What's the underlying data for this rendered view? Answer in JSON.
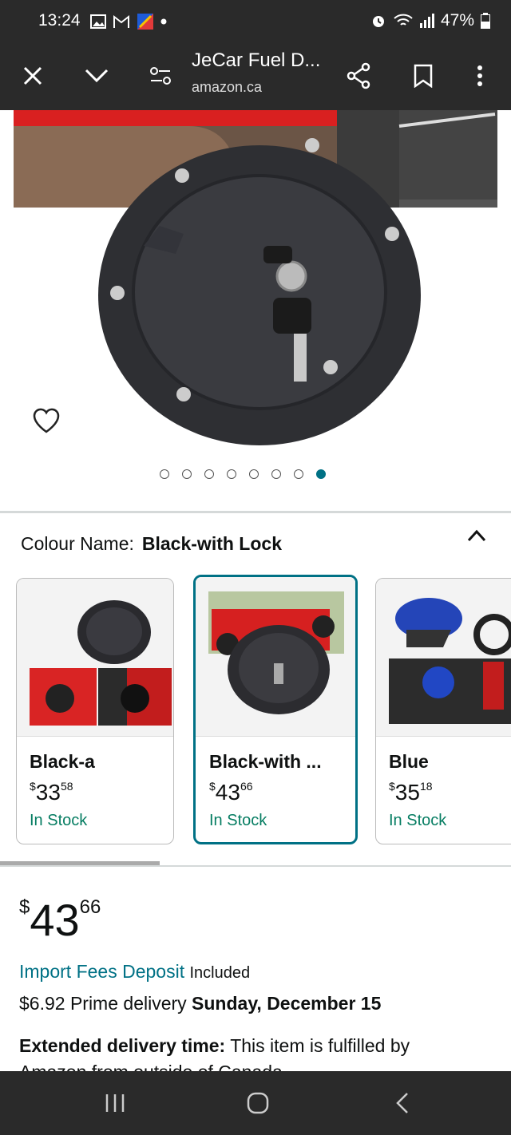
{
  "status_bar": {
    "time": "13:24",
    "battery": "47%"
  },
  "toolbar": {
    "title": "JeCar Fuel D...",
    "url": "amazon.ca"
  },
  "gallery": {
    "dot_count": 8,
    "active_dot": 7
  },
  "colour": {
    "label": "Colour Name:",
    "value": "Black-with Lock"
  },
  "variants": [
    {
      "name": "Black-a",
      "dollars": "33",
      "cents": "58",
      "stock": "In Stock"
    },
    {
      "name": "Black-with ...",
      "dollars": "43",
      "cents": "66",
      "stock": "In Stock"
    },
    {
      "name": "Blue",
      "dollars": "35",
      "cents": "18",
      "stock": "In Stock"
    }
  ],
  "price": {
    "currency": "$",
    "dollars": "43",
    "cents": "66"
  },
  "import_fees": {
    "link": "Import Fees Deposit",
    "suffix": "Included"
  },
  "delivery": {
    "prefix": "$6.92 Prime delivery",
    "date": "Sunday, December 15"
  },
  "extended": {
    "label": "Extended delivery time:",
    "text": "This item is fulfilled by",
    "cut_line": "Amazon from outside of Canada"
  },
  "colors": {
    "accent": "#007185",
    "in_stock": "#067d62"
  }
}
